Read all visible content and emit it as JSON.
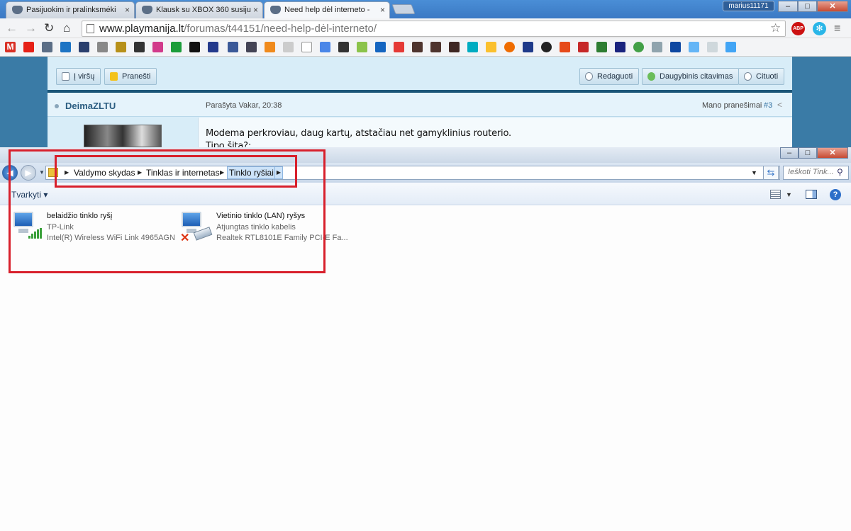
{
  "browser": {
    "tabs": [
      {
        "label": "Pasijuokim ir pralinksmėki",
        "close": "×"
      },
      {
        "label": "Klausk su XBOX 360 susiju",
        "close": "×"
      },
      {
        "label": "Need help dėl interneto -",
        "close": "×"
      }
    ],
    "user_badge": "marius11171",
    "window_buttons": {
      "minimize": "–",
      "maximize": "□",
      "close": "✕"
    },
    "url_host": "www.playmanija.lt",
    "url_path": "/forumas/t44151/need-help-dėl-interneto/",
    "abp_label": "ABP",
    "icons": [
      "back-arrow-icon",
      "forward-arrow-icon",
      "reload-icon",
      "home-icon",
      "star-icon",
      "adblock-icon",
      "extension-icon",
      "menu-icon"
    ]
  },
  "forum": {
    "buttons_left": [
      {
        "label": "Į viršų",
        "icon_color": "#ffffff"
      },
      {
        "label": "Pranešti",
        "icon_color": "#f3c21a"
      }
    ],
    "buttons_right": [
      {
        "label": "Redaguoti"
      },
      {
        "label": "Daugybinis citavimas"
      },
      {
        "label": "Cituoti"
      }
    ],
    "author": "DeimaZLTU",
    "posted": "Parašyta Vakar, 20:38",
    "my_posts": "Mano pranešimai",
    "post_number": "#3",
    "post_text": "Modema perkroviau, daug kartų, atstačiau net gamyklinius routerio.\nTipo šita?:"
  },
  "explorer": {
    "window_buttons": {
      "minimize": "–",
      "maximize": "□",
      "close": "✕"
    },
    "breadcrumbs": [
      "Valdymo skydas",
      "Tinklas ir internetas",
      "Tinklo ryšiai"
    ],
    "search_placeholder": "Ieškoti Tink...",
    "organize_label": "Tvarkyti ▾",
    "connections": [
      {
        "name": "belaidžio tinklo ryšį",
        "network": "TP-Link",
        "device": "Intel(R) Wireless WiFi Link 4965AGN",
        "status_icon": "wifi-signal-icon"
      },
      {
        "name": "Vietinio tinklo (LAN) ryšys",
        "network": "Atjungtas tinklo kabelis",
        "device": "Realtek RTL8101E Family PCI-E Fa...",
        "status_icon": "disconnected-x-icon"
      }
    ]
  },
  "annotation_color": "#d8202c"
}
